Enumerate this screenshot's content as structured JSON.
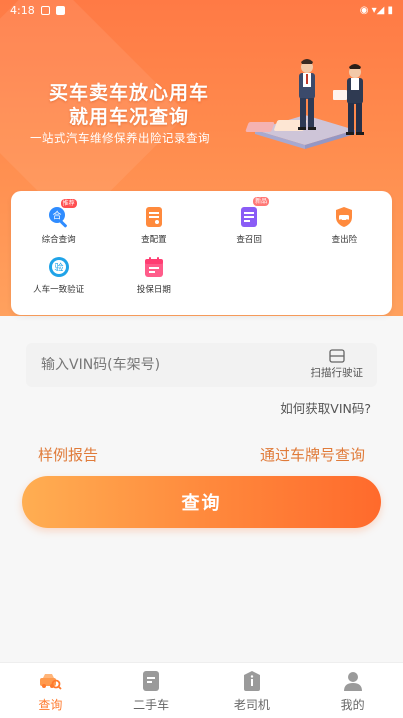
{
  "status_bar": {
    "time": "4:18",
    "right_text": "◉ ▾◢ ▮"
  },
  "hero": {
    "headline_line1": "买车卖车放心用车",
    "headline_line2": "就用车况查询",
    "subtitle": "一站式汽车维修保养出险记录查询"
  },
  "features": [
    {
      "label": "综合查询",
      "badge": "推荐",
      "icon": "search-combo-icon"
    },
    {
      "label": "查配置",
      "badge": "",
      "icon": "config-doc-icon"
    },
    {
      "label": "查召回",
      "badge": "新品",
      "icon": "recall-doc-icon"
    },
    {
      "label": "查出险",
      "badge": "",
      "icon": "car-shield-icon"
    },
    {
      "label": "人车一致验证",
      "badge": "",
      "icon": "verify-icon"
    },
    {
      "label": "投保日期",
      "badge": "",
      "icon": "calendar-icon"
    }
  ],
  "vin": {
    "placeholder": "输入VIN码(车架号)",
    "scan_label": "扫描行驶证",
    "help_link": "如何获取VIN码?"
  },
  "links": {
    "sample_report": "样例报告",
    "plate_query": "通过车牌号查询"
  },
  "query_button": "查询",
  "nav": [
    {
      "label": "查询",
      "active": true,
      "icon": "car-search-icon"
    },
    {
      "label": "二手车",
      "active": false,
      "icon": "document-icon"
    },
    {
      "label": "老司机",
      "active": false,
      "icon": "info-box-icon"
    },
    {
      "label": "我的",
      "active": false,
      "icon": "user-icon"
    }
  ],
  "colors": {
    "accent": "#ff7a2e",
    "link": "#e07b3a",
    "hero_top": "#ff7a45",
    "hero_bottom": "#ffa15e"
  }
}
